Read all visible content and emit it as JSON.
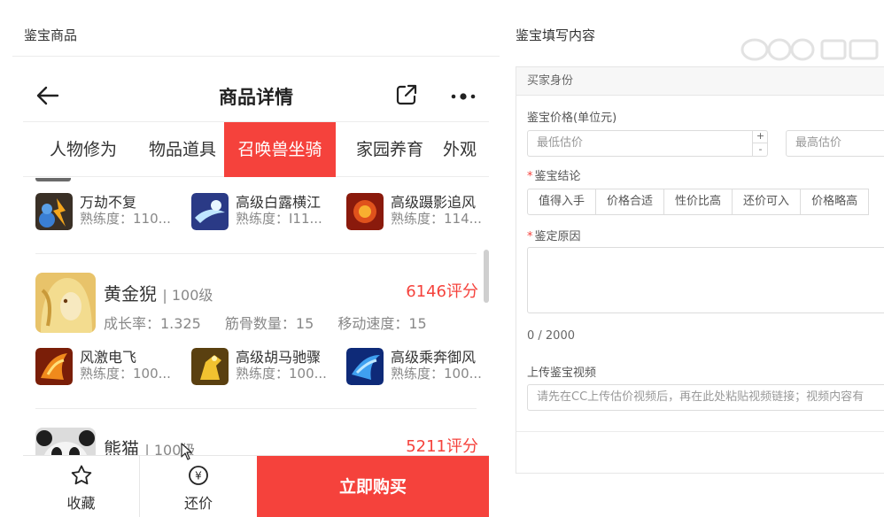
{
  "left": {
    "panel_title": "鉴宝商品",
    "page_title": "商品详情",
    "tabs": [
      "人物修为",
      "物品道具",
      "召唤兽坐骑",
      "家园养育",
      "外观"
    ],
    "active_tab": 2,
    "top_skills": [
      {
        "name": "万劫不复",
        "proficiency": "熟练度：110..."
      },
      {
        "name": "高级白露横江",
        "proficiency": "熟练度：I11..."
      },
      {
        "name": "高级蹑影追风",
        "proficiency": "熟练度：114..."
      }
    ],
    "pets": [
      {
        "name": "黄金猊",
        "level": "| 100级",
        "score": "6146评分",
        "stats": [
          "成长率：1.325",
          "筋骨数量：15",
          "移动速度：15"
        ],
        "skills": [
          {
            "name": "风激电飞",
            "proficiency": "熟练度：100..."
          },
          {
            "name": "高级胡马驰骤",
            "proficiency": "熟练度：100..."
          },
          {
            "name": "高级乘奔御风",
            "proficiency": "熟练度：100..."
          }
        ]
      },
      {
        "name": "熊猫",
        "level": "| 100级",
        "score": "5211评分"
      }
    ],
    "bottom": {
      "favorite_label": "收藏",
      "bargain_label": "还价",
      "bargain_icon_text": "¥",
      "buy_label": "立即购买"
    }
  },
  "right": {
    "panel_title": "鉴宝填写内容",
    "section_title": "买家身份",
    "price_label": "鉴宝价格(单位元)",
    "min_price_placeholder": "最低估价",
    "max_price_placeholder": "最高估价",
    "stepper_plus": "+",
    "stepper_minus": "-",
    "required_mark": "*",
    "conclusion_label": "鉴宝结论",
    "conclusion_options": [
      "值得入手",
      "价格合适",
      "性价比高",
      "还价可入",
      "价格略高"
    ],
    "reason_label": "鉴定原因",
    "reason_count": "0 / 2000",
    "video_label": "上传鉴宝视频",
    "video_placeholder": "请先在CC上传估价视频后，再在此处粘贴视频链接；视频内容有"
  },
  "colors": {
    "accent": "#f5423c",
    "border": "#dcdcdc"
  }
}
